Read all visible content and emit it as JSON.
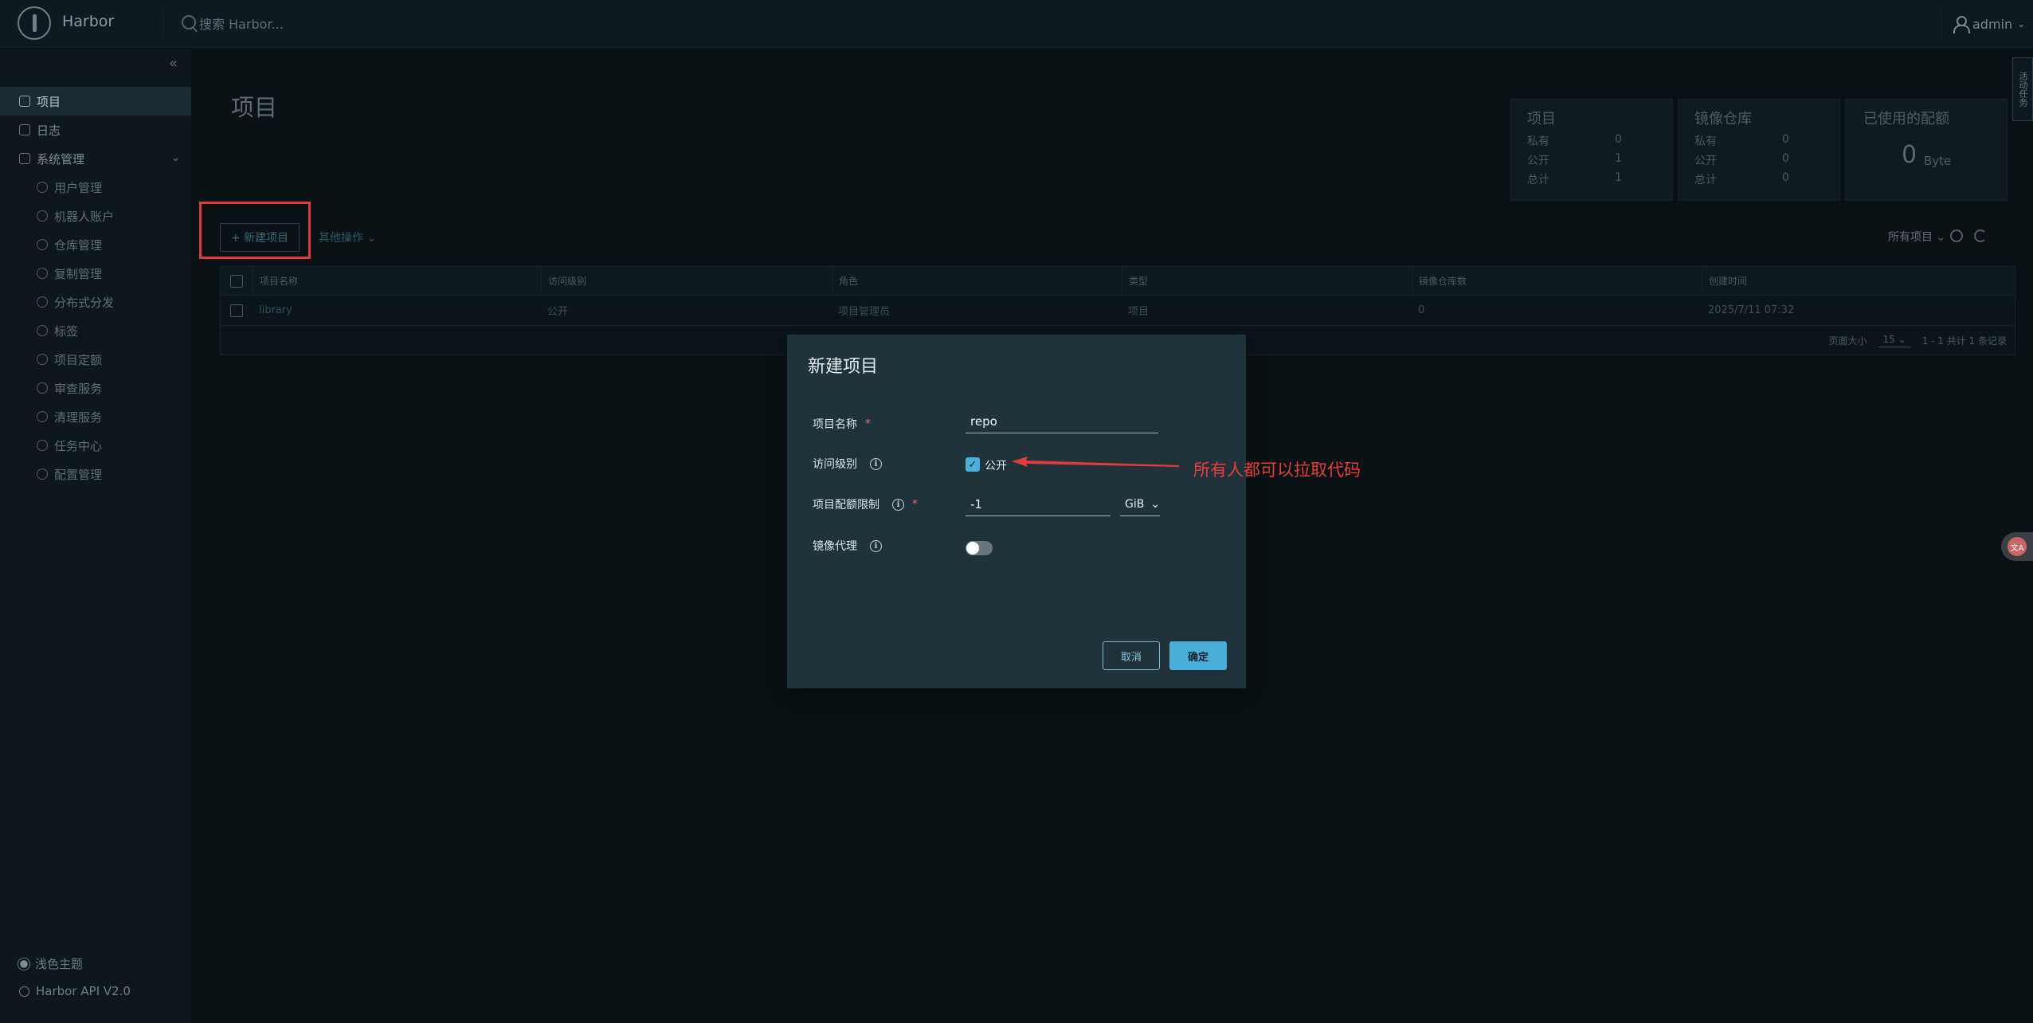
{
  "header": {
    "app_title": "Harbor",
    "search_placeholder": "搜索 Harbor...",
    "user": "admin"
  },
  "sidebar": {
    "items": [
      {
        "label": "项目",
        "active": true
      },
      {
        "label": "日志"
      },
      {
        "label": "系统管理"
      }
    ],
    "sub_items": [
      {
        "label": "用户管理"
      },
      {
        "label": "机器人账户"
      },
      {
        "label": "仓库管理"
      },
      {
        "label": "复制管理"
      },
      {
        "label": "分布式分发"
      },
      {
        "label": "标签"
      },
      {
        "label": "项目定额"
      },
      {
        "label": "审查服务"
      },
      {
        "label": "清理服务"
      },
      {
        "label": "任务中心"
      },
      {
        "label": "配置管理"
      }
    ],
    "footer_theme": "浅色主题",
    "footer_api": "Harbor API V2.0"
  },
  "main": {
    "title": "项目",
    "stats": {
      "projects": {
        "title": "项目",
        "rows": [
          {
            "label": "私有",
            "value": "0"
          },
          {
            "label": "公开",
            "value": "1"
          },
          {
            "label": "总计",
            "value": "1"
          }
        ]
      },
      "repos": {
        "title": "镜像仓库",
        "rows": [
          {
            "label": "私有",
            "value": "0"
          },
          {
            "label": "公开",
            "value": "0"
          },
          {
            "label": "总计",
            "value": "0"
          }
        ]
      },
      "quota": {
        "title": "已使用的配额",
        "value": "0",
        "unit": "Byte"
      }
    },
    "new_project_label": "+ 新建项目",
    "other_actions_label": "其他操作",
    "filter_label": "所有项目",
    "table": {
      "headers": [
        "项目名称",
        "访问级别",
        "角色",
        "类型",
        "镜像仓库数",
        "创建时间"
      ],
      "rows": [
        [
          "library",
          "公开",
          "项目管理员",
          "项目",
          "0",
          "2025/7/11 07:32"
        ]
      ],
      "page_size_label": "页面大小",
      "page_size": "15",
      "summary": "1 - 1 共计 1 条记录"
    }
  },
  "right_tab": "活动任务",
  "modal": {
    "title": "新建项目",
    "name_label": "项目名称",
    "name_value": "repo",
    "access_label": "访问级别",
    "public_label": "公开",
    "public_checked": true,
    "quota_label": "项目配额限制",
    "quota_value": "-1",
    "quota_unit": "GiB",
    "proxy_label": "镜像代理",
    "proxy_enabled": false,
    "cancel_label": "取消",
    "ok_label": "确定"
  },
  "annotation": {
    "text": "所有人都可以拉取代码",
    "color": "#ea3b3b"
  }
}
